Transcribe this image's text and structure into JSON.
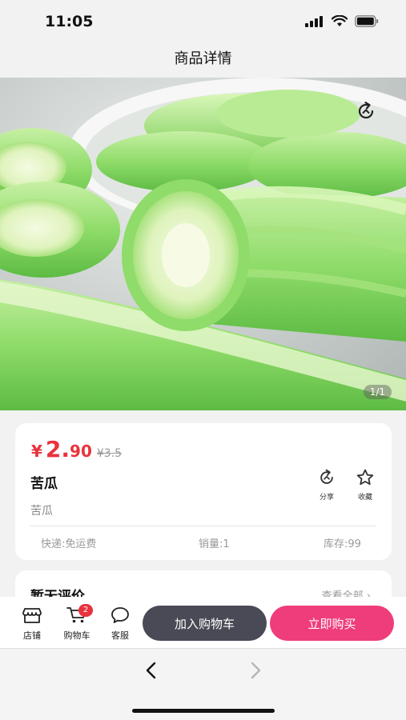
{
  "status_bar": {
    "time": "11:05"
  },
  "header": {
    "title": "商品详情"
  },
  "hero": {
    "image_counter": "1/1",
    "share_icon": "share-icon"
  },
  "product": {
    "currency_symbol": "¥",
    "price_integer": "2.",
    "price_decimal": "90",
    "original_price": "¥3.5",
    "name": "苦瓜",
    "subtitle": "苦瓜",
    "share_label": "分享",
    "favorite_label": "收藏",
    "shipping": "快递:免运费",
    "sales": "销量:1",
    "stock": "库存:99"
  },
  "reviews": {
    "title": "暂无评价",
    "view_all": "查看全部"
  },
  "bottom_bar": {
    "shop_label": "店铺",
    "cart_label": "购物车",
    "cart_count": "2",
    "service_label": "客服",
    "add_to_cart": "加入购物车",
    "buy_now": "立即购买"
  },
  "colors": {
    "price": "#e8333d",
    "buy_button": "#ef3d7c",
    "cart_button": "#4a4a56"
  }
}
